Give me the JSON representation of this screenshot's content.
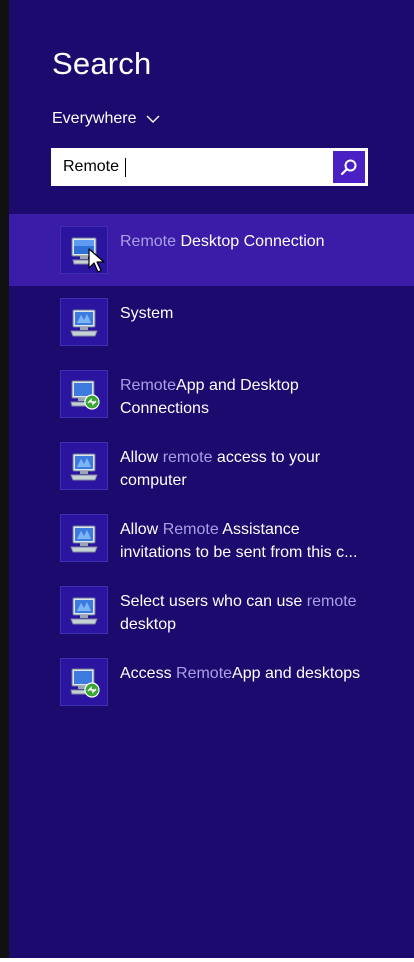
{
  "panel": {
    "title": "Search",
    "scope_label": "Everywhere",
    "search_value": "Remote",
    "search_placeholder": ""
  },
  "colors": {
    "panel_bg": "#1c0a6e",
    "selected_bg": "#3a1ca8",
    "highlight_text": "#a99fe6",
    "search_button": "#4a1fc4"
  },
  "results": [
    {
      "icon": "remote-desktop-icon",
      "selected": true,
      "line1": [
        {
          "text": "Remote",
          "hl": true
        },
        {
          "text": " Desktop Connection",
          "hl": false
        }
      ],
      "line2": []
    },
    {
      "icon": "system-icon",
      "selected": false,
      "line1": [
        {
          "text": "System",
          "hl": false
        }
      ],
      "line2": []
    },
    {
      "icon": "remoteapp-icon",
      "selected": false,
      "line1": [
        {
          "text": "Remote",
          "hl": true
        },
        {
          "text": "App and Desktop",
          "hl": false
        }
      ],
      "line2": [
        {
          "text": "Connections",
          "hl": false
        }
      ]
    },
    {
      "icon": "system-icon",
      "selected": false,
      "line1": [
        {
          "text": "Allow ",
          "hl": false
        },
        {
          "text": "remote",
          "hl": true
        },
        {
          "text": " access to your",
          "hl": false
        }
      ],
      "line2": [
        {
          "text": "computer",
          "hl": false
        }
      ]
    },
    {
      "icon": "system-icon",
      "selected": false,
      "line1": [
        {
          "text": "Allow ",
          "hl": false
        },
        {
          "text": "Remote",
          "hl": true
        },
        {
          "text": " Assistance",
          "hl": false
        }
      ],
      "line2": [
        {
          "text": "invitations to be sent from this c...",
          "hl": false
        }
      ]
    },
    {
      "icon": "system-icon",
      "selected": false,
      "line1": [
        {
          "text": "Select users who can use ",
          "hl": false
        },
        {
          "text": "remote",
          "hl": true
        }
      ],
      "line2": [
        {
          "text": "desktop",
          "hl": false
        }
      ]
    },
    {
      "icon": "remoteapp-icon",
      "selected": false,
      "line1": [
        {
          "text": "Access ",
          "hl": false
        },
        {
          "text": "Remote",
          "hl": true
        },
        {
          "text": "App and desktops",
          "hl": false
        }
      ],
      "line2": []
    }
  ]
}
